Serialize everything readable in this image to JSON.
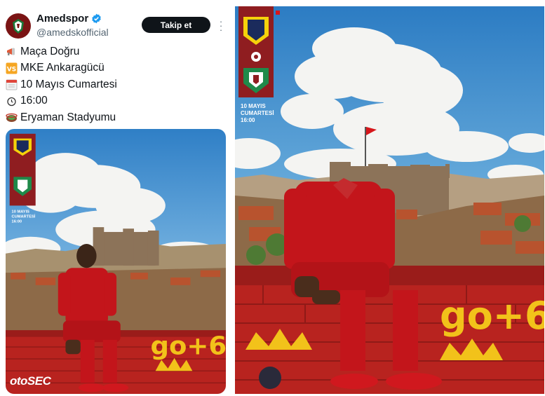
{
  "tweet": {
    "author": {
      "name": "Amedspor",
      "handle": "@amedskofficial"
    },
    "follow_label": "Takip et",
    "lines": [
      {
        "icon": "megaphone-icon",
        "text": "Maça Doğru"
      },
      {
        "icon": "vs-icon",
        "text": "MKE Ankaragücü"
      },
      {
        "icon": "calendar-icon",
        "text": "10 Mayıs Cumartesi"
      },
      {
        "icon": "clock-icon",
        "text": "16:00"
      },
      {
        "icon": "stadium-icon",
        "text": "Eryaman Stadyumu"
      }
    ],
    "watermark": "otoSEC"
  },
  "poster": {
    "banner_date": "10 MAYIS",
    "banner_day": "CUMARTESİ",
    "banner_time": "16:00",
    "graffiti": "go+6"
  },
  "colors": {
    "sky": "#3f8fd0",
    "cloud": "#f4f4f2",
    "banner_red": "#8f1d20",
    "kit_red": "#c3151b",
    "wall": "#b8231f",
    "graffiti_yellow": "#f2c21a",
    "verified_blue": "#1d9bf0"
  }
}
